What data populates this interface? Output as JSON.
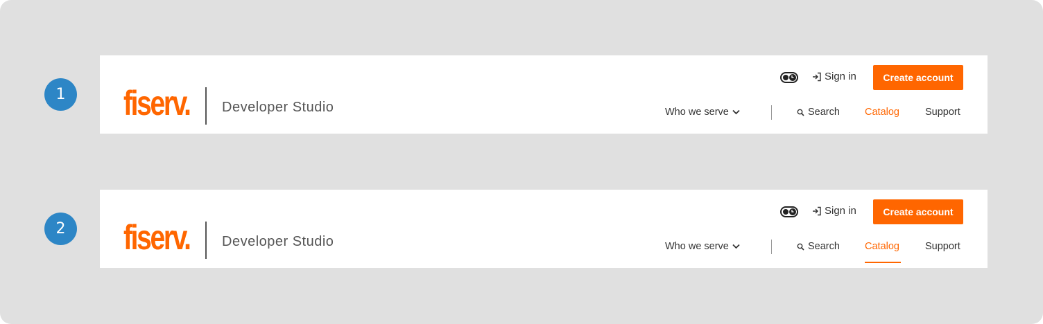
{
  "variants": [
    {
      "badge": "1",
      "logo_text": "fiserv.",
      "product_name": "Developer Studio",
      "sign_in": "Sign in",
      "create_account": "Create account",
      "nav": {
        "who_we_serve": "Who we serve",
        "search": "Search",
        "catalog": "Catalog",
        "support": "Support"
      },
      "active_nav": "Catalog",
      "active_underline": false
    },
    {
      "badge": "2",
      "logo_text": "fiserv.",
      "product_name": "Developer Studio",
      "sign_in": "Sign in",
      "create_account": "Create account",
      "nav": {
        "who_we_serve": "Who we serve",
        "search": "Search",
        "catalog": "Catalog",
        "support": "Support"
      },
      "active_nav": "Catalog",
      "active_underline": true
    }
  ],
  "colors": {
    "brand": "#ff6600",
    "badge": "#2d86c6",
    "text": "#333333",
    "canvas": "#e0e0e0"
  },
  "icons": [
    "theme-toggle-icon",
    "sign-in-icon",
    "chevron-down-icon",
    "search-icon"
  ]
}
